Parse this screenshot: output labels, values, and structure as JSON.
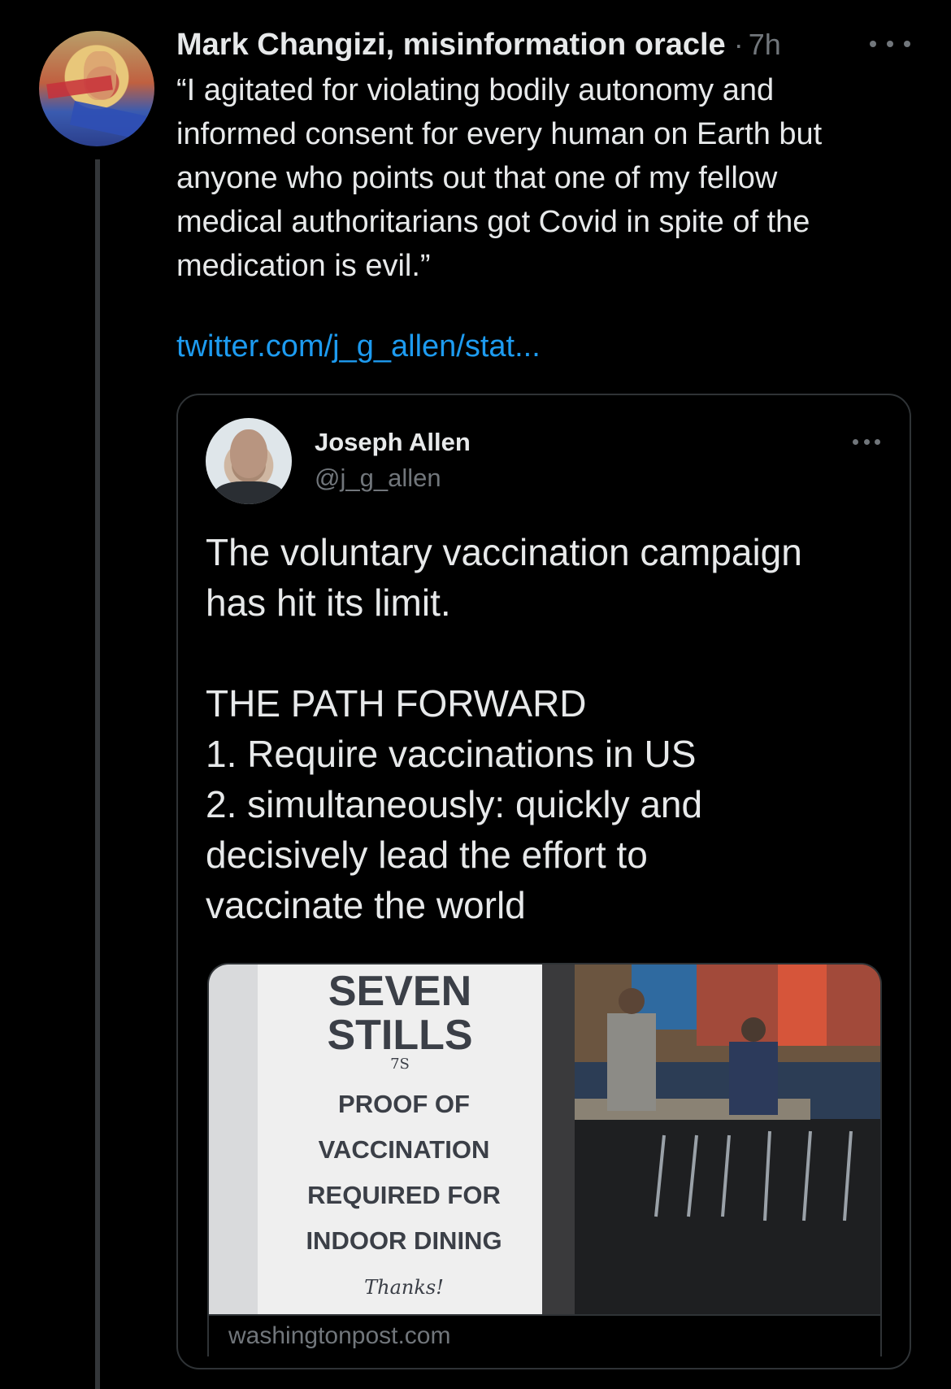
{
  "tweet": {
    "author": "Mark Changizi, misinformation oracle",
    "separator": "·",
    "time": "7h",
    "text": "“I agitated for violating bodily autonomy and\ninformed consent for every human on Earth but\nanyone who points out that one of my fellow\nmedical authoritarians got Covid in spite of the\nmedication is evil.”",
    "link": "twitter.com/j_g_allen/stat...",
    "avatar_icon": "painted-portrait-avatar",
    "more_icon": "more-options-icon"
  },
  "quoted": {
    "name": "Joseph Allen",
    "handle": "@j_g_allen",
    "text": "The voluntary vaccination campaign\nhas hit its limit.\n\nTHE PATH FORWARD\n1. Require vaccinations in US\n2. simultaneously: quickly and\ndecisively lead the effort to\nvaccinate the world",
    "media": {
      "sign_title_1": "SEVEN",
      "sign_title_2": "STILLS",
      "sign_logo": "7S",
      "sign_lines": [
        "PROOF OF",
        "VACCINATION",
        "REQUIRED FOR",
        "INDOOR DINING"
      ],
      "sign_footer": "Thanks!",
      "domain": "washingtonpost.com"
    }
  },
  "colors": {
    "background": "#000000",
    "text": "#e7e9ea",
    "muted": "#71767b",
    "link": "#1d9bf0",
    "border": "#2f3336"
  }
}
